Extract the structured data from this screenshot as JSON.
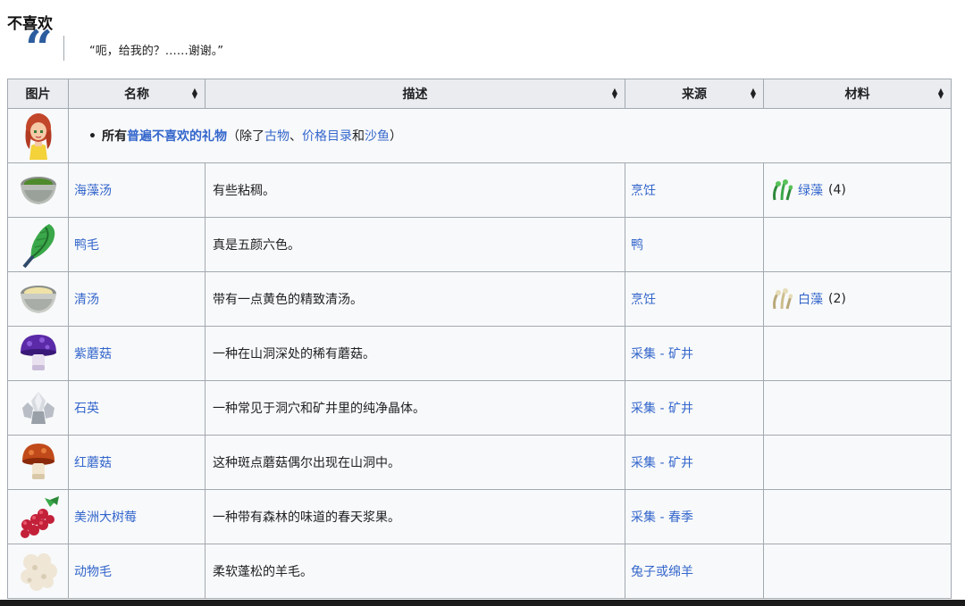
{
  "section": {
    "title": "不喜欢",
    "quote": "“呃，给我的？……谢谢。”"
  },
  "table": {
    "headers": [
      "图片",
      "名称",
      "描述",
      "来源",
      "材料"
    ],
    "general": {
      "prefix": "所有",
      "link": "普遍不喜欢的礼物",
      "paren_open": "（除了",
      "ex1": "古物",
      "sep1": "、",
      "ex2": "价格目录",
      "sep2": "和",
      "ex3": "沙鱼",
      "paren_close": "）"
    },
    "rows": [
      {
        "icon": "seaweed-soup-icon",
        "name": "海藻汤",
        "desc": "有些粘稠。",
        "source": "烹饪",
        "mat_icon": "green-algae-icon",
        "mat_name": "绿藻",
        "mat_count": "(4)"
      },
      {
        "icon": "duck-feather-icon",
        "name": "鸭毛",
        "desc": "真是五颜六色。",
        "source": "鸭",
        "mat_icon": "",
        "mat_name": "",
        "mat_count": ""
      },
      {
        "icon": "consomme-icon",
        "name": "清汤",
        "desc": "带有一点黄色的精致清汤。",
        "source": "烹饪",
        "mat_icon": "white-algae-icon",
        "mat_name": "白藻",
        "mat_count": "(2)"
      },
      {
        "icon": "purple-mushroom-icon",
        "name": "紫蘑菇",
        "desc": "一种在山洞深处的稀有蘑菇。",
        "source": "采集 - 矿井",
        "mat_icon": "",
        "mat_name": "",
        "mat_count": ""
      },
      {
        "icon": "quartz-icon",
        "name": "石英",
        "desc": "一种常见于洞穴和矿井里的纯净晶体。",
        "source": "采集 - 矿井",
        "mat_icon": "",
        "mat_name": "",
        "mat_count": ""
      },
      {
        "icon": "red-mushroom-icon",
        "name": "红蘑菇",
        "desc": "这种斑点蘑菇偶尔出现在山洞中。",
        "source": "采集 - 矿井",
        "mat_icon": "",
        "mat_name": "",
        "mat_count": ""
      },
      {
        "icon": "salmonberry-icon",
        "name": "美洲大树莓",
        "desc": "一种带有森林的味道的春天浆果。",
        "source": "采集 - 春季",
        "mat_icon": "",
        "mat_name": "",
        "mat_count": ""
      },
      {
        "icon": "wool-icon",
        "name": "动物毛",
        "desc": "柔软蓬松的羊毛。",
        "source": "兔子或绵羊",
        "mat_icon": "",
        "mat_name": "",
        "mat_count": ""
      }
    ]
  }
}
